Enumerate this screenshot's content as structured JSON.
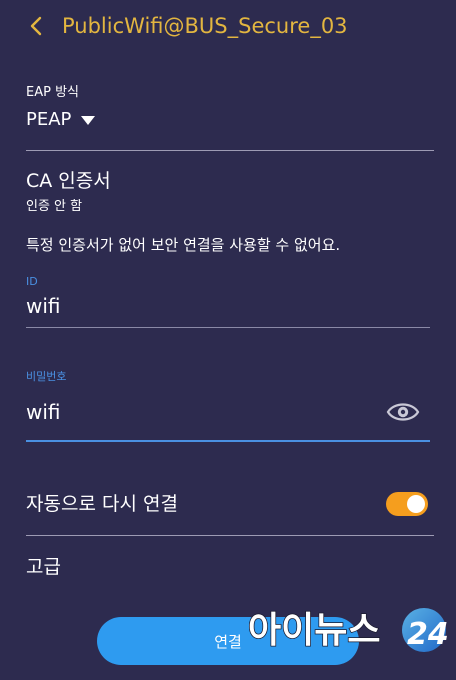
{
  "header": {
    "title": "PublicWifi@BUS_Secure_03",
    "back_icon": "chevron-left-icon"
  },
  "eap": {
    "label": "EAP 방식",
    "value": "PEAP"
  },
  "ca": {
    "title": "CA 인증서",
    "value": "인증 안 함",
    "warning": "특정 인증서가 없어 보안 연결을 사용할 수 없어요."
  },
  "id_field": {
    "label": "ID",
    "value": "wifi"
  },
  "password_field": {
    "label": "비밀번호",
    "value": "wifi",
    "icon": "eye-icon"
  },
  "auto_reconnect": {
    "label": "자동으로 다시 연결",
    "enabled": true
  },
  "advanced": {
    "label": "고급"
  },
  "connect_button": {
    "label": "연결"
  },
  "watermark": {
    "text": "아이뉴스24"
  },
  "colors": {
    "background": "#2d2b4f",
    "title_accent": "#e3b640",
    "field_label": "#4a90e2",
    "toggle_on": "#f59e1e",
    "button": "#2e9bf0"
  }
}
